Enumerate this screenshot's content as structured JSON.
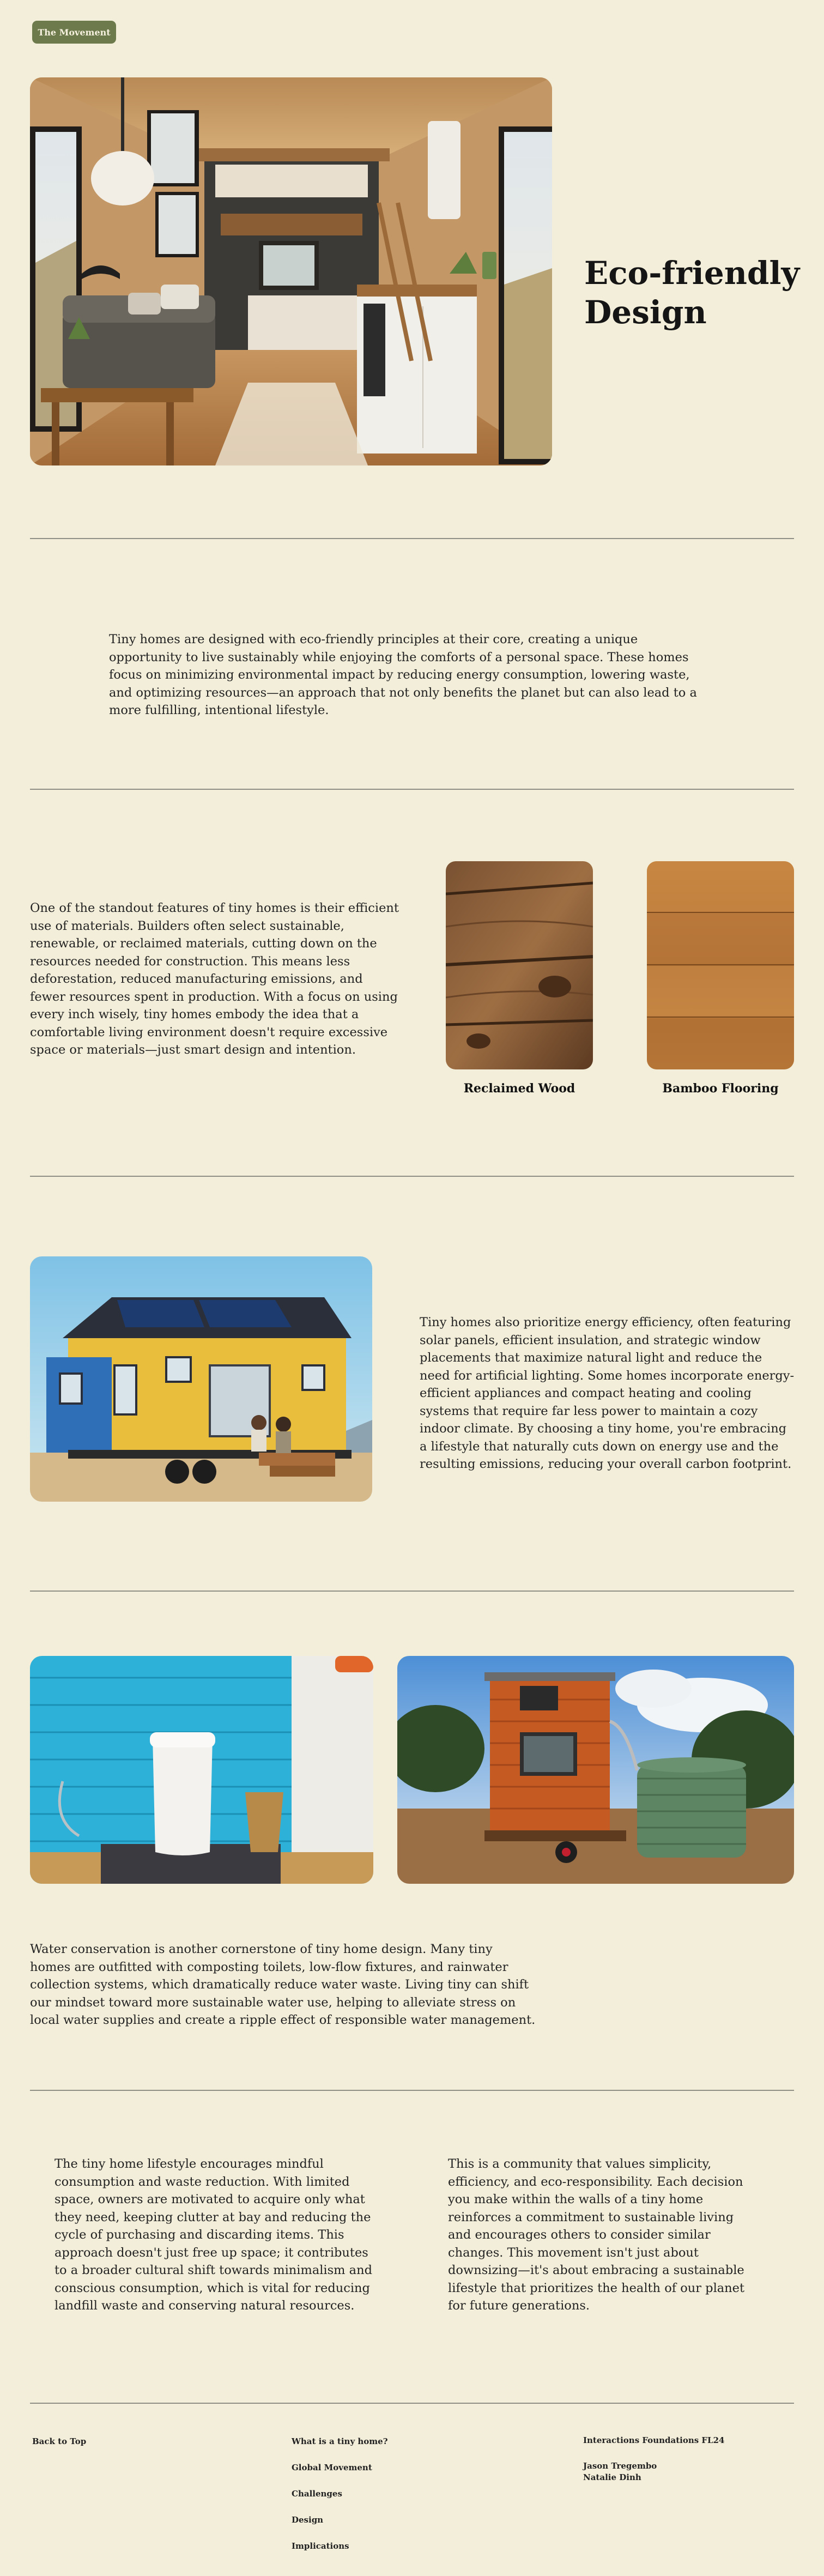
{
  "header": {
    "badge_label": "The Movement"
  },
  "hero": {
    "title_line1": "Eco-friendly",
    "title_line2": "Design"
  },
  "intro": {
    "text": "Tiny homes are designed with eco-friendly principles at their core, creating a unique opportunity to live sustainably while enjoying the comforts of a personal space. These homes focus on minimizing environmental impact by reducing energy consumption, lowering waste, and optimizing resources—an approach that not only benefits the planet but can also lead to a more fulfilling, intentional lifestyle."
  },
  "materials": {
    "text": "One of the standout features of tiny homes is their efficient use of materials. Builders often select sustainable, renewable, or reclaimed materials, cutting down on the resources needed for construction. This means less deforestation, reduced manufacturing emissions, and fewer resources spent in production. With a focus on using every inch wisely, tiny homes embody the idea that a comfortable living environment doesn't require excessive space or materials—just smart design and intention.",
    "caption_reclaimed": "Reclaimed Wood",
    "caption_bamboo": "Bamboo Flooring"
  },
  "energy": {
    "text": "Tiny homes also prioritize energy efficiency, often featuring solar panels, efficient insulation, and strategic window placements that maximize natural light and reduce the need for artificial lighting. Some homes incorporate energy-efficient appliances and compact heating and cooling systems that require far less power to maintain a cozy indoor climate. By choosing a tiny home, you're embracing a lifestyle that naturally cuts down on energy use and the resulting emissions, reducing your overall carbon footprint."
  },
  "water": {
    "text": "Water conservation is another cornerstone of tiny home design. Many tiny homes are outfitted with composting toilets, low-flow fixtures, and rainwater collection systems, which dramatically reduce water waste. Living tiny can shift our mindset toward more sustainable water use, helping to alleviate stress on local water supplies and create a ripple effect of responsible water management."
  },
  "lifestyle": {
    "left_text": "The tiny home lifestyle encourages mindful consumption and waste reduction. With limited space, owners are motivated to acquire only what they need, keeping clutter at bay and reducing the cycle of purchasing and discarding items. This approach doesn't just free up space; it contributes to a broader cultural shift towards minimalism and conscious consumption, which is vital for reducing landfill waste and conserving natural resources.",
    "right_text": "This is a community that values simplicity, efficiency, and eco-responsibility. Each decision you make within the walls of a tiny home reinforces a commitment to sustainable living and encourages others to consider similar changes. This movement isn't just about downsizing—it's about embracing a sustainable lifestyle that prioritizes the health of our planet for future generations."
  },
  "footer": {
    "back_to_top": "Back to Top",
    "nav": [
      "What is a tiny home?",
      "Global Movement",
      "Challenges",
      "Design",
      "Implications"
    ],
    "course": "Interactions Foundations FL24",
    "authors": [
      "Jason Tregembo",
      "Natalie Dinh"
    ]
  }
}
